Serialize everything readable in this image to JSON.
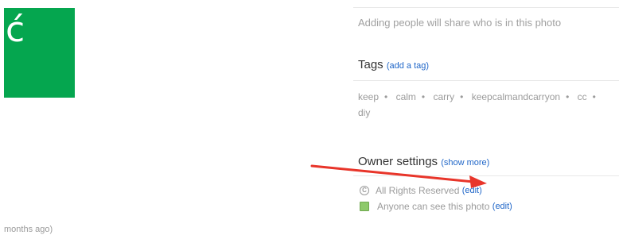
{
  "photo": {
    "thumbnail_glyph": "ć",
    "thumbnail_color": "#05a64f"
  },
  "uploaded": {
    "time_ago": "months ago)"
  },
  "people": {
    "hint": "Adding people will share who is in this photo"
  },
  "tags_section": {
    "title": "Tags",
    "add_link": "(add a tag)",
    "tags": [
      "keep",
      "calm",
      "carry",
      "keepcalmandcarryon",
      "cc",
      "diy"
    ],
    "separator": "•"
  },
  "owner_settings": {
    "title": "Owner settings",
    "show_more": "(show more)",
    "license": {
      "icon": "copyright-icon",
      "text": "All Rights Reserved",
      "edit": "(edit)"
    },
    "visibility": {
      "icon": "public-privacy-icon",
      "text": "Anyone can see this photo",
      "edit": "(edit)"
    }
  },
  "annotation": {
    "arrow_color": "#e8352a"
  }
}
